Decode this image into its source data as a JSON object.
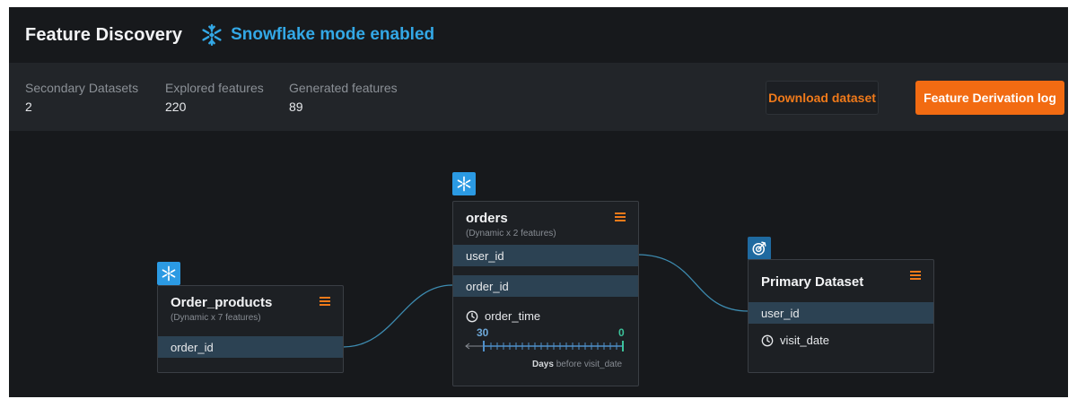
{
  "header": {
    "title": "Feature Discovery",
    "mode_label": "Snowflake mode enabled",
    "mode_icon": "snowflake-icon",
    "accent_color": "#33a8e6"
  },
  "stats": [
    {
      "label": "Secondary Datasets",
      "value": "2"
    },
    {
      "label": "Explored features",
      "value": "220"
    },
    {
      "label": "Generated features",
      "value": "89"
    }
  ],
  "actions": {
    "download_label": "Download dataset",
    "derivation_log_label": "Feature Derivation log",
    "primary_color": "#f26b12"
  },
  "graph": {
    "order_products": {
      "title": "Order_products",
      "subtitle": "(Dynamic x 7 features)",
      "rows": [
        "order_id"
      ],
      "badge_icon": "snowflake-icon",
      "menu_icon": "menu-icon"
    },
    "orders": {
      "title": "orders",
      "subtitle": "(Dynamic x 2 features)",
      "rows": [
        "user_id",
        "order_id"
      ],
      "time_field": "order_time",
      "window": {
        "start": "30",
        "end": "0",
        "unit_bold": "Days",
        "unit_rest": "before visit_date"
      },
      "badge_icon": "snowflake-icon",
      "menu_icon": "menu-icon"
    },
    "primary": {
      "title": "Primary Dataset",
      "rows": [
        "user_id"
      ],
      "time_field": "visit_date",
      "badge_icon": "target-icon",
      "menu_icon": "menu-icon"
    },
    "edge_color": "#3d8bb0"
  }
}
